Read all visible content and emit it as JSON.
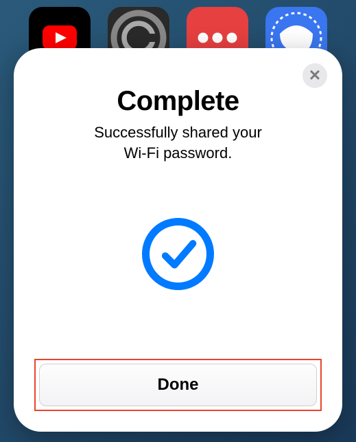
{
  "background_apps": {
    "youtube": "youtube-icon",
    "circle_g": "circle-g-icon",
    "dots": "dots-icon",
    "signal": "signal-icon"
  },
  "modal": {
    "title": "Complete",
    "subtitle_line1": "Successfully shared your",
    "subtitle_line2": "Wi-Fi password.",
    "done_label": "Done",
    "close_label": "✕"
  },
  "colors": {
    "accent_blue": "#007aff",
    "highlight_red": "#e8442e"
  }
}
